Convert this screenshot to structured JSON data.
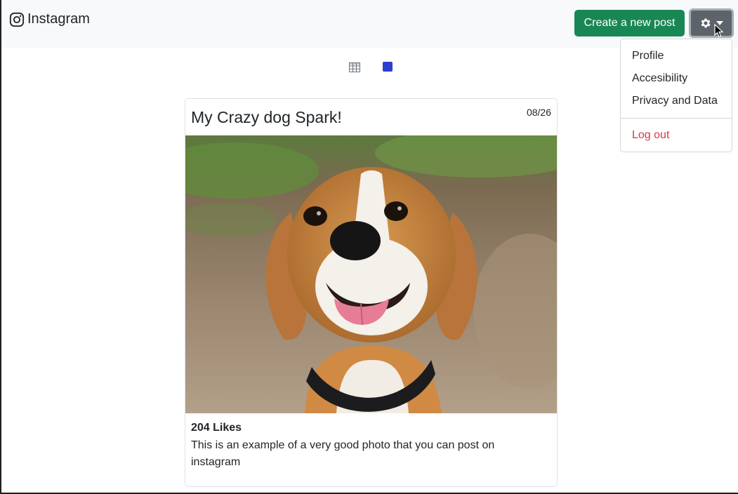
{
  "navbar": {
    "brand": "Instagram",
    "create_label": "Create a new post"
  },
  "settings_menu": {
    "items": [
      "Profile",
      "Accesibility",
      "Privacy and Data"
    ],
    "logout": "Log out"
  },
  "view_toggle": {
    "options": [
      "grid-view",
      "single-view"
    ],
    "selected": "single-view",
    "accent": "#2d3fcf"
  },
  "post": {
    "title": "My Crazy dog Spark!",
    "date": "08/26",
    "likes": "204 Likes",
    "caption": "This is an example of a very good photo that you can post on instagram"
  },
  "colors": {
    "success": "#198754",
    "secondary": "#5c636a",
    "danger": "#dc3545"
  }
}
